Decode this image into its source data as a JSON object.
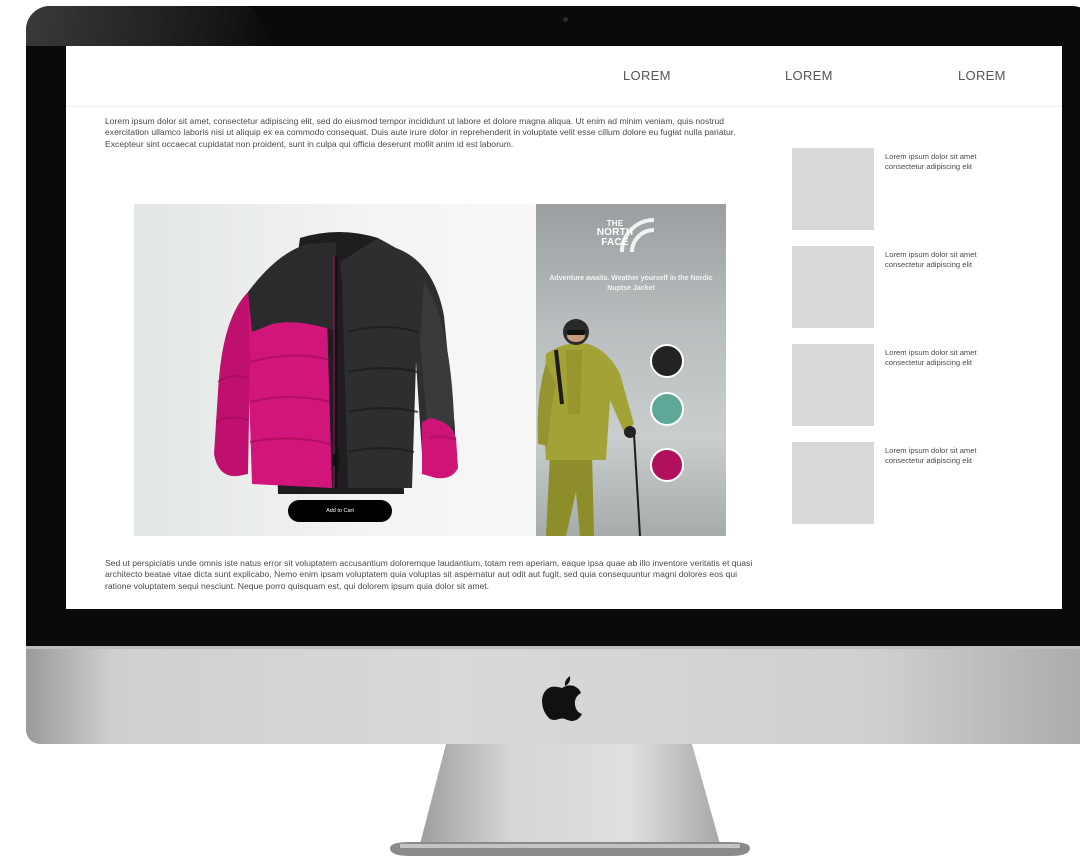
{
  "nav": {
    "items": [
      "LOREM",
      "LOREM",
      "LOREM"
    ]
  },
  "content": {
    "intro": "Lorem ipsum dolor sit amet, consectetur adipiscing elit, sed do eiusmod tempor incididunt ut labore et dolore magna aliqua. Ut enim ad minim veniam, quis nostrud exercitation ullamco laboris nisi ut aliquip ex ea commodo consequat. Duis aute irure dolor in reprehenderit in voluptate velit esse cillum dolore eu fugiat nulla pariatur. Excepteur sint occaecat cupidatat non proident, sunt in culpa qui officia deserunt mollit anim id est laborum.",
    "outro": "Sed ut perspiciatis unde omnis iste natus error sit voluptatem accusantium doloremque laudantium, totam rem aperiam, eaque ipsa quae ab illo inventore veritatis et quasi architecto beatae vitae dicta sunt explicabo. Nemo enim ipsam voluptatem quia voluptas sit aspernatur aut odit aut fugit, sed quia consequuntur magni dolores eos qui ratione voluptatem sequi nesciunt. Neque porro quisquam est, qui dolorem ipsum quia dolor sit amet."
  },
  "banner": {
    "cart_label": "Add to Cart",
    "brand": [
      "THE",
      "NORTH",
      "FACE"
    ],
    "tagline": "Adventure awaits. Weather yourself in the Nordic Nuptse Jacket",
    "swatches": [
      {
        "color": "#232325",
        "name": "black"
      },
      {
        "color": "#5fa898",
        "name": "teal"
      },
      {
        "color": "#b0105e",
        "name": "pink"
      }
    ],
    "jacket_colors": {
      "body": "#d1157a",
      "yoke": "#2b2a2c"
    }
  },
  "sidebar": {
    "items": [
      {
        "text": "Lorem ipsum dolor sit amet consectetur adipiscing elit"
      },
      {
        "text": "Lorem ipsum dolor sit amet consectetur adipiscing elit"
      },
      {
        "text": "Lorem ipsum dolor sit amet consectetur adipiscing elit"
      },
      {
        "text": "Lorem ipsum dolor sit amet consectetur adipiscing elit"
      }
    ]
  }
}
